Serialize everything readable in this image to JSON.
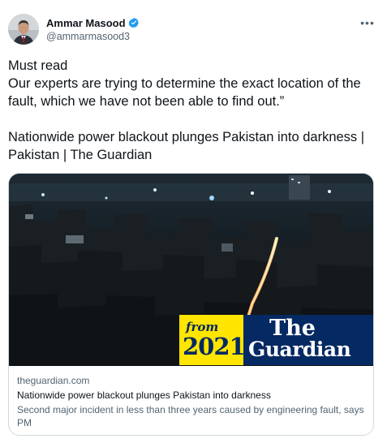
{
  "author": {
    "name": "Ammar Masood",
    "handle": "@ammarmasood3",
    "verified": true
  },
  "tweet": {
    "text": "Must read\nOur experts are trying to determine the exact location of the fault, which we have not been able to find out.”\n\nNationwide power blackout plunges Pakistan into darkness | Pakistan | The Guardian"
  },
  "card": {
    "domain": "theguardian.com",
    "title": "Nationwide power blackout plunges Pakistan into darkness",
    "description": "Second major incident in less than three years caused by engineering fault, says PM",
    "badge": {
      "from": "from",
      "year": "2021",
      "brand_line1": "The",
      "brand_line2": "Guardian"
    }
  },
  "icons": {
    "more": "more-options-icon",
    "verified": "verified-badge-icon"
  },
  "colors": {
    "verified_blue": "#1d9bf0",
    "guardian_navy": "#052962",
    "guardian_yellow": "#ffe500",
    "text_primary": "#0f1419",
    "text_secondary": "#536471"
  }
}
